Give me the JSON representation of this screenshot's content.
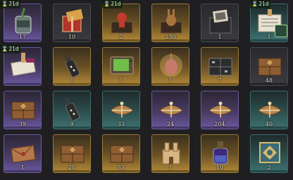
{
  "timer_glyph": "⌛",
  "items": [
    {
      "icon": "jar-with-plant-icon",
      "count": "17",
      "rarity": "purple",
      "timer": "21d"
    },
    {
      "icon": "red-gift-box-icon",
      "count": "10",
      "rarity": "dark",
      "timer": ""
    },
    {
      "icon": "red-toy-in-box-icon",
      "count": "2",
      "rarity": "gold",
      "timer": "21d"
    },
    {
      "icon": "brown-rabbit-in-box-icon",
      "count": "230",
      "rarity": "gold",
      "timer": ""
    },
    {
      "icon": "photo-album-box-icon",
      "count": "1",
      "rarity": "dark",
      "timer": ""
    },
    {
      "icon": "manuscript-parcel-icon",
      "count": "1",
      "rarity": "teal",
      "timer": "21d"
    },
    {
      "icon": "wrapped-manuscript-icon",
      "count": "",
      "rarity": "purple",
      "timer": "21d"
    },
    {
      "icon": "bottle-icon",
      "count": "1",
      "rarity": "gold",
      "timer": ""
    },
    {
      "icon": "green-tv-icon",
      "count": "1",
      "rarity": "gold",
      "timer": ""
    },
    {
      "icon": "glowing-onion-icon",
      "count": "1",
      "rarity": "gold",
      "timer": ""
    },
    {
      "icon": "black-cargo-crate-icon",
      "count": "7",
      "rarity": "gold",
      "timer": ""
    },
    {
      "icon": "wooden-crate-icon",
      "count": "48",
      "rarity": "dark",
      "timer": ""
    },
    {
      "icon": "wooden-crate-icon",
      "count": "39",
      "rarity": "purple",
      "timer": ""
    },
    {
      "icon": "bottle-icon",
      "count": "9",
      "rarity": "teal",
      "timer": ""
    },
    {
      "icon": "tied-parcel-icon",
      "count": "33",
      "rarity": "teal",
      "timer": ""
    },
    {
      "icon": "tied-parcel-icon",
      "count": "24",
      "rarity": "purple",
      "timer": ""
    },
    {
      "icon": "tied-parcel-icon",
      "count": "204",
      "rarity": "purple",
      "timer": ""
    },
    {
      "icon": "tied-parcel-icon",
      "count": "40",
      "rarity": "teal",
      "timer": ""
    },
    {
      "icon": "envelope-icon",
      "count": "1",
      "rarity": "purple",
      "timer": ""
    },
    {
      "icon": "wooden-crate-icon",
      "count": "20",
      "rarity": "gold",
      "timer": ""
    },
    {
      "icon": "wooden-crate-icon",
      "count": "53",
      "rarity": "gold",
      "timer": ""
    },
    {
      "icon": "sand-castle-icon",
      "count": "1",
      "rarity": "gold",
      "timer": ""
    },
    {
      "icon": "potion-bottle-icon",
      "count": "10",
      "rarity": "gold",
      "timer": ""
    },
    {
      "icon": "ornate-tile-icon",
      "count": "2",
      "rarity": "teal",
      "timer": ""
    }
  ]
}
